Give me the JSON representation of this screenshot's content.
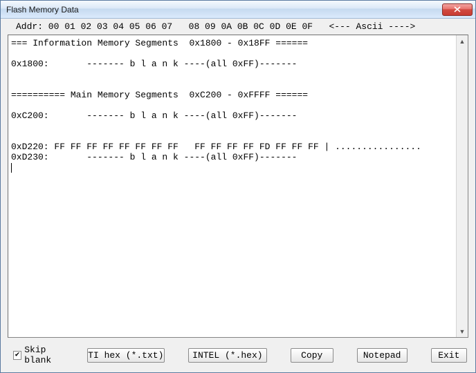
{
  "window": {
    "title": "Flash Memory Data"
  },
  "header": "Addr: 00 01 02 03 04 05 06 07   08 09 0A 0B 0C 0D 0E 0F   <--- Ascii ---->",
  "content": {
    "line1": "=== Information Memory Segments  0x1800 - 0x18FF ======",
    "line2": "0x1800:       ------- b l a n k ----(all 0xFF)-------",
    "line3": "========== Main Memory Segments  0xC200 - 0xFFFF ======",
    "line4": "0xC200:       ------- b l a n k ----(all 0xFF)-------",
    "line5": "0xD220: FF FF FF FF FF FF FF FF   FF FF FF FF FD FF FF FF | ................",
    "line6": "0xD230:       ------- b l a n k ----(all 0xFF)-------"
  },
  "footer": {
    "skip_blank_label": "Skip blank",
    "skip_blank_checked": true,
    "ti_hex_label": "TI hex (*.txt)",
    "intel_hex_label": "INTEL (*.hex)",
    "copy_label": "Copy",
    "notepad_label": "Notepad",
    "exit_label": "Exit"
  }
}
